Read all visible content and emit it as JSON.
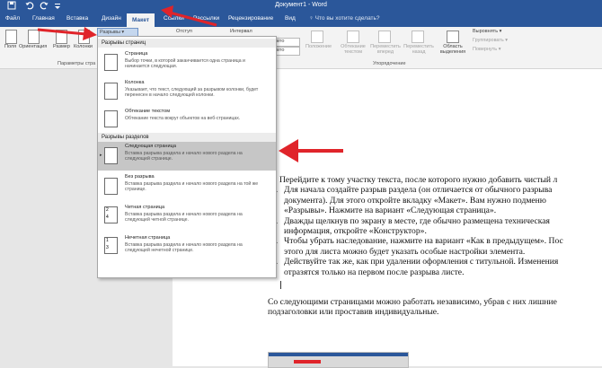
{
  "window": {
    "title": "Документ1 - Word",
    "quick_access_icons": [
      "save-icon",
      "undo-icon",
      "redo-icon",
      "customize-icon"
    ]
  },
  "tabs": [
    {
      "label": "Файл"
    },
    {
      "label": "Главная"
    },
    {
      "label": "Вставка"
    },
    {
      "label": "Дизайн"
    },
    {
      "label": "Макет"
    },
    {
      "label": "Ссылки"
    },
    {
      "label": "Рассылки"
    },
    {
      "label": "Рецензирование"
    },
    {
      "label": "Вид"
    }
  ],
  "tell_me": "♀ Что вы хотите сделать?",
  "ribbon": {
    "buttons": {
      "fields": "Поля",
      "orientation": "Ориентация",
      "size": "Размер",
      "columns": "Колонки",
      "breaks": "Разрывы ▾",
      "indent": "Отступ",
      "spacing": "Интервал",
      "spin1": "авто",
      "spin2": "авто",
      "position": "Положение",
      "wrap_text": "Обтекание текстом",
      "bring_forward": "Переместить вперед",
      "send_backward": "Переместить назад",
      "selection_pane": "Область выделения",
      "align": "Выровнять ▾",
      "group": "Группировать ▾",
      "rotate": "Повернуть ▾"
    },
    "groups": {
      "page_setup": "Параметры стра",
      "arrange": "Упорядочение"
    }
  },
  "breaks_menu": {
    "page_breaks_header": "Разрывы страниц",
    "section_breaks_header": "Разрывы разделов",
    "items": [
      {
        "title": "Страница",
        "desc": "Выбор точки, в которой заканчивается одна страница и начинается следующая."
      },
      {
        "title": "Колонка",
        "desc": "Указывает, что текст, следующий за разрывом колонки, будет перенесен в начало следующей колонки."
      },
      {
        "title": "Обтекание текстом",
        "desc": "Обтекание текста вокруг объектов на веб-страницах."
      },
      {
        "title": "Следующая страница",
        "desc": "Вставка разрыва раздела и начало нового раздела на следующей странице."
      },
      {
        "title": "Без разрыва",
        "desc": "Вставка разрыва раздела и начало нового раздела на той же странице."
      },
      {
        "title": "Четная страница",
        "desc": "Вставка разрыва раздела и начало нового раздела на следующей четной странице."
      },
      {
        "title": "Нечетная страница",
        "desc": "Вставка разрыва раздела и начало нового раздела на следующей нечетной странице."
      }
    ],
    "thumb_numbers": [
      "2",
      "4",
      "1",
      "3"
    ]
  },
  "document": {
    "intro": "Перейдите к тому участку текста, после которого нужно добавить чистый л",
    "steps": [
      {
        "num": "1.",
        "lines": [
          "Для начала создайте разрыв раздела (он отличается от обычного разрыва",
          "документа). Для этого откройте вкладку «Макет». Вам нужно подменю",
          "«Разрывы». Нажмите на вариант «Следующая страница»."
        ]
      },
      {
        "num": "2.",
        "lines": [
          "Дважды щелкнув по экрану в месте, где обычно размещена техническая",
          "информация, откройте «Конструктор»."
        ]
      },
      {
        "num": "3.",
        "lines": [
          "Чтобы убрать наследование, нажмите на вариант «Как в предыдущем». Пос",
          "этого для листа можно будет указать особые настройки элемента."
        ]
      },
      {
        "num": "4.",
        "lines": [
          "Действуйте так же, как при удалении оформления с титульной. Изменения",
          "отразятся только на первом после разрыва листе."
        ]
      }
    ],
    "outro_lines": [
      "Со следующими страницами можно работать независимо, убрав с них лишние",
      "подзаголовки или проставив индивидуальные."
    ]
  },
  "colors": {
    "word_blue": "#2b579a",
    "arrow_red": "#e0242a",
    "highlight": "#c6c6c6"
  }
}
